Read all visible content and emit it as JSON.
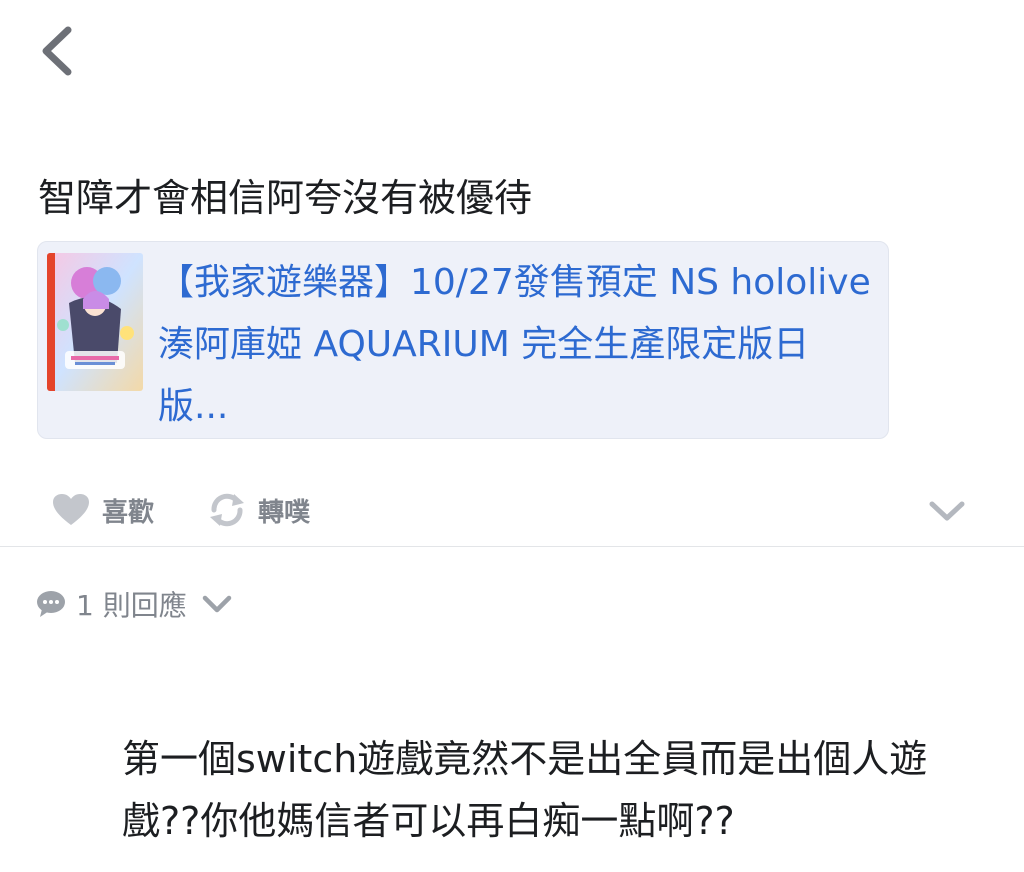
{
  "nav": {
    "back_icon": "chevron-left-icon"
  },
  "post": {
    "text": "智障才會相信阿夸沒有被優待",
    "link_card": {
      "title": "【我家遊樂器】10/27發售預定 NS hololive 湊阿庫婭 AQUARIUM 完全生產限定版日版...",
      "link_color": "#2d6ad1",
      "background": "#eef1f9"
    },
    "actions": {
      "like_label": "喜歡",
      "like_icon": "heart-icon",
      "share_label": "轉噗",
      "share_icon": "repost-icon",
      "more_icon": "chevron-down-icon"
    }
  },
  "replies": {
    "toggle_label": "1 則回應",
    "icon": "comment-bubble-icon",
    "chevron_icon": "chevron-down-icon"
  },
  "reply": {
    "text": "第一個switch遊戲竟然不是出全員而是出個人遊戲??你他媽信者可以再白痴一點啊??"
  },
  "colors": {
    "text": "#1c1e21",
    "muted": "#80858d",
    "divider": "#e3e5e8"
  }
}
